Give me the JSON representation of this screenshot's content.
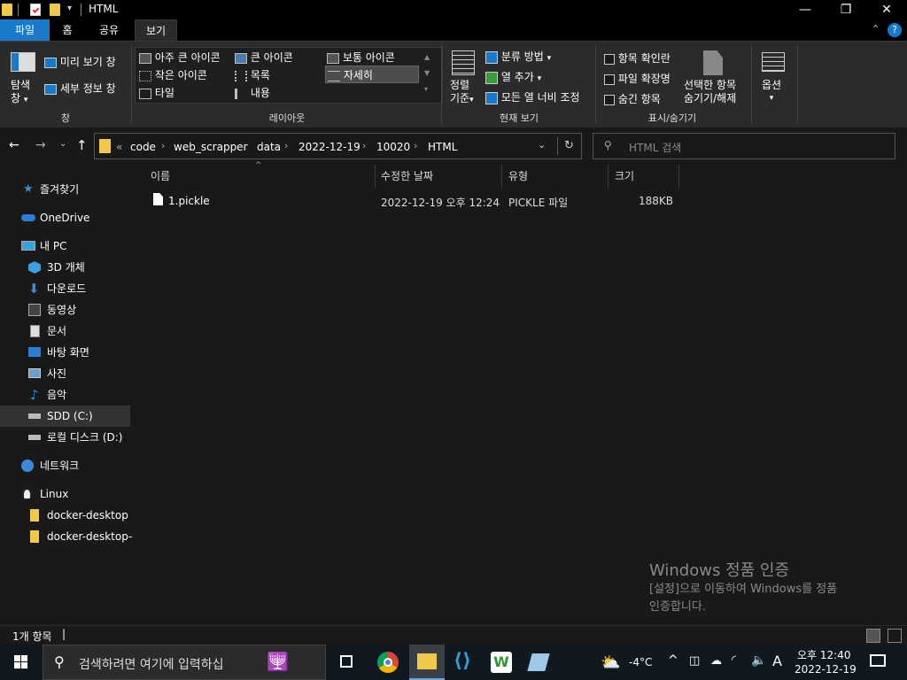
{
  "window": {
    "title": "HTML",
    "minimize": "—",
    "maximize": "❐",
    "close": "✕"
  },
  "tabs": {
    "file": "파일",
    "home": "홈",
    "share": "공유",
    "view": "보기"
  },
  "ribbon": {
    "pane": {
      "nav_pane": "탐색\n창",
      "nav_pane_1": "탐색",
      "nav_pane_2": "창",
      "preview": "미리 보기 창",
      "details": "세부 정보 창",
      "group": "창"
    },
    "layout": {
      "extra_large": "아주 큰 아이콘",
      "large": "큰 아이콘",
      "medium": "보통 아이콘",
      "small": "작은 아이콘",
      "list": "목록",
      "details": "자세히",
      "tiles": "타일",
      "content": "내용",
      "group": "레이아웃"
    },
    "current_view": {
      "sort_1": "정렬",
      "sort_2": "기준",
      "group_by": "분류 방법",
      "add_columns": "열 추가",
      "size_all": "모든 열 너비 조정",
      "group": "현재 보기"
    },
    "show_hide": {
      "checkboxes": "항목 확인란",
      "extensions": "파일 확장명",
      "hidden": "숨긴 항목",
      "hide_selected_1": "선택한 항목",
      "hide_selected_2": "숨기기/해제",
      "group": "표시/숨기기"
    },
    "options": {
      "label": "옵션"
    }
  },
  "address": {
    "overflow": "«",
    "crumbs": [
      "code",
      "web_scrapper",
      "data",
      "2022-12-19",
      "10020",
      "HTML"
    ],
    "search_placeholder": "HTML 검색"
  },
  "nav": {
    "quick_access": "즐겨찾기",
    "onedrive": "OneDrive",
    "this_pc": "내 PC",
    "objects3d": "3D 개체",
    "downloads": "다운로드",
    "videos": "동영상",
    "documents": "문서",
    "desktop": "바탕 화면",
    "pictures": "사진",
    "music": "음악",
    "drive_c": "SDD (C:)",
    "drive_d": "로컬 디스크 (D:)",
    "network": "네트워크",
    "linux": "Linux",
    "docker1": "docker-desktop",
    "docker2": "docker-desktop-d"
  },
  "columns": {
    "name": "이름",
    "modified": "수정한 날짜",
    "type": "유형",
    "size": "크기"
  },
  "files": [
    {
      "name": "1.pickle",
      "modified": "2022-12-19 오후 12:24",
      "type": "PICKLE 파일",
      "size": "188KB"
    }
  ],
  "activation": {
    "title": "Windows 정품 인증",
    "line1": "[설정]으로 이동하여 Windows를 정품",
    "line2": "인증합니다."
  },
  "status": {
    "count": "1개 항목",
    "cursor": "|"
  },
  "taskbar": {
    "search_placeholder": "검색하려면 여기에 입력하십",
    "weather": "-4°C",
    "ime": "A",
    "time": "오후 12:40",
    "date": "2022-12-19"
  },
  "colors": {
    "accent": "#1979ca",
    "bg": "#191919",
    "ribbon": "#2b2b2b"
  }
}
